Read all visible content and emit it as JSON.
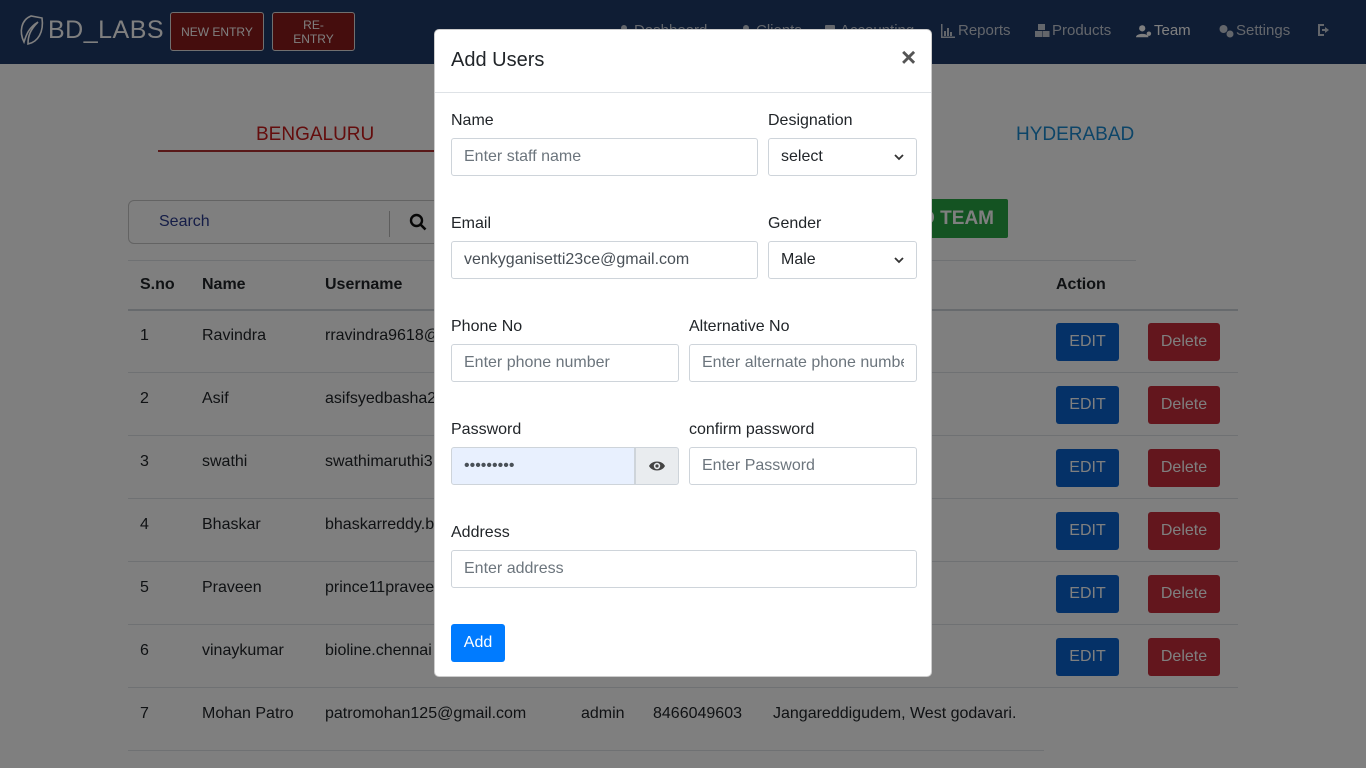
{
  "navbar": {
    "brand": "BD_LABS",
    "new_entry": "NEW ENTRY",
    "re_entry": "RE-ENTRY",
    "links": [
      {
        "label": "Dashboard"
      },
      {
        "label": "Clients"
      },
      {
        "label": "Accounting"
      },
      {
        "label": "Reports"
      },
      {
        "label": "Products"
      },
      {
        "label": "Team"
      },
      {
        "label": "Settings"
      }
    ]
  },
  "tabs": {
    "bengaluru": "BENGALURU",
    "hyderabad": "HYDERABAD"
  },
  "search": {
    "placeholder": "Search"
  },
  "add_team_label": "ADD TEAM",
  "table": {
    "headers": {
      "sno": "S.no",
      "name": "Name",
      "username": "Username",
      "action": "Action"
    },
    "edit_label": "EDIT",
    "delete_label": "Delete",
    "rows": [
      {
        "sno": "1",
        "name": "Ravindra",
        "username": "rravindra9618@"
      },
      {
        "sno": "2",
        "name": "Asif",
        "username": "asifsyedbasha2"
      },
      {
        "sno": "3",
        "name": "swathi",
        "username": "swathimaruthi3"
      },
      {
        "sno": "4",
        "name": "Bhaskar",
        "username": "bhaskarreddy.b"
      },
      {
        "sno": "5",
        "name": "Praveen",
        "username": "prince11pravee"
      },
      {
        "sno": "6",
        "name": "vinaykumar",
        "username": "bioline.chennai"
      },
      {
        "sno": "7",
        "name": "Mohan Patro",
        "username": "patromohan125@gmail.com",
        "designation": "admin",
        "phone": "8466049603",
        "address": "Jangareddigudem, West godavari."
      }
    ]
  },
  "modal": {
    "title": "Add Users",
    "close": "×",
    "name_label": "Name",
    "name_placeholder": "Enter staff name",
    "designation_label": "Designation",
    "designation_value": "select",
    "email_label": "Email",
    "email_value": "venkyganisetti23ce@gmail.com",
    "gender_label": "Gender",
    "gender_value": "Male",
    "phone_label": "Phone No",
    "phone_placeholder": "Enter phone number",
    "alt_label": "Alternative No",
    "alt_placeholder": "Enter alternate phone number",
    "password_label": "Password",
    "password_value": "•••••••••",
    "confirm_label": "confirm password",
    "confirm_placeholder": "Enter Password",
    "address_label": "Address",
    "address_placeholder": "Enter address",
    "add_label": "Add"
  },
  "colors": {
    "navbar": "#1f3a68",
    "edit": "#0b63ce",
    "delete": "#c62d3a",
    "add_team": "#28a745",
    "primary": "#007bff"
  }
}
